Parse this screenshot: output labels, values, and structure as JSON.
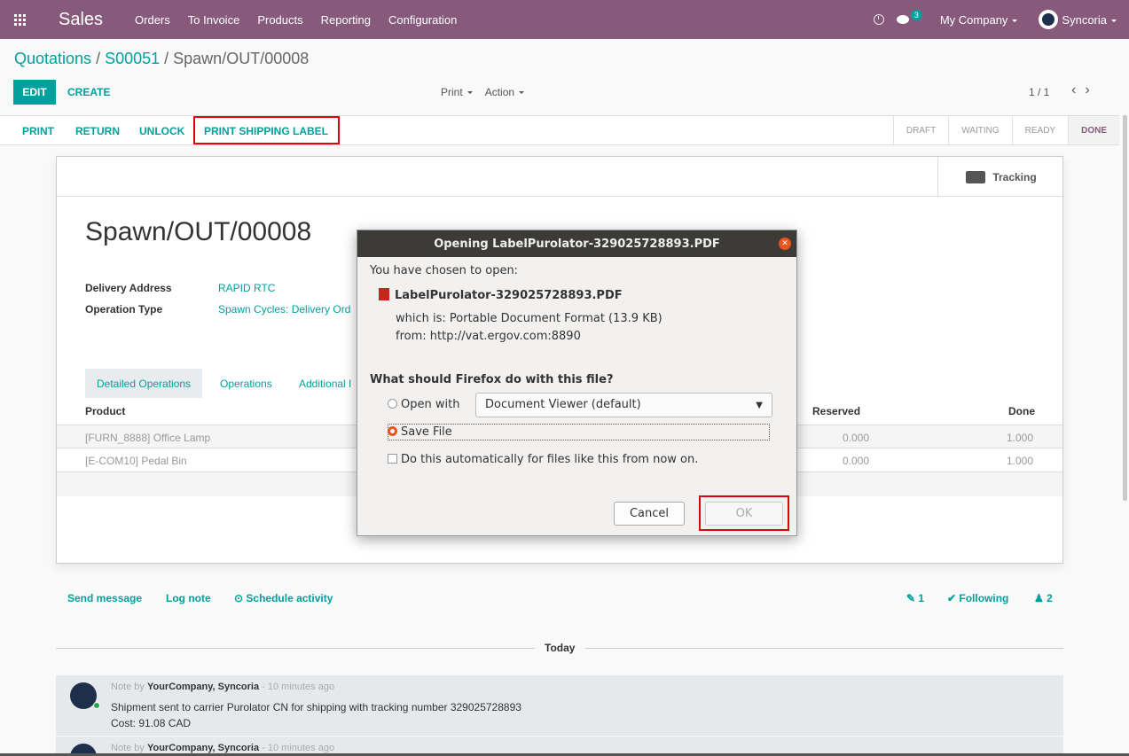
{
  "navbar": {
    "app_name": "Sales",
    "menu": [
      "Orders",
      "To Invoice",
      "Products",
      "Reporting",
      "Configuration"
    ],
    "messages_badge": "3",
    "company": "My Company",
    "user": "Syncoria"
  },
  "breadcrumb": {
    "part1": "Quotations",
    "sep1": " / ",
    "part2": "S00051",
    "sep2": " / ",
    "current": "Spawn/OUT/00008"
  },
  "control_panel": {
    "edit": "EDIT",
    "create": "CREATE",
    "print": "Print",
    "action": "Action",
    "pager": "1 / 1",
    "pager_prev": "‹",
    "pager_next": "›"
  },
  "statusbar": {
    "buttons": [
      "PRINT",
      "RETURN",
      "UNLOCK",
      "PRINT SHIPPING LABEL"
    ],
    "stages": [
      "DRAFT",
      "WAITING",
      "READY",
      "DONE"
    ],
    "active_stage": "DONE"
  },
  "sheet": {
    "tracking": "Tracking",
    "title": "Spawn/OUT/00008",
    "fields": [
      {
        "label": "Delivery Address",
        "value": "RAPID RTC"
      },
      {
        "label": "Operation Type",
        "value": "Spawn Cycles: Delivery Ord"
      }
    ],
    "tabs": [
      "Detailed Operations",
      "Operations",
      "Additional I"
    ],
    "columns": {
      "product": "Product",
      "reserved": "Reserved",
      "done": "Done"
    },
    "rows": [
      {
        "product": "[FURN_8888] Office Lamp",
        "reserved": "0.000",
        "done": "1.000"
      },
      {
        "product": "[E-COM10] Pedal Bin",
        "reserved": "0.000",
        "done": "1.000"
      }
    ]
  },
  "chatter": {
    "send_message": "Send message",
    "log_note": "Log note",
    "schedule_activity": "⊙ Schedule activity",
    "attachments": "✎ 1",
    "following": "✔ Following",
    "followers": "♟ 2",
    "today": "Today",
    "messages": [
      {
        "prefix": "Note by ",
        "author": "YourCompany, Syncoria",
        "time": " - 10 minutes ago",
        "line1": "Shipment sent to carrier Purolator CN for shipping with tracking number 329025728893",
        "line2": "Cost: 91.08 CAD"
      },
      {
        "prefix": "Note by ",
        "author": "YourCompany, Syncoria",
        "time": " - 10 minutes ago"
      }
    ]
  },
  "dialog": {
    "title": "Opening LabelPurolator-329025728893.PDF",
    "chosen": "You have chosen to open:",
    "filename": "LabelPurolator-329025728893.PDF",
    "which_is": "which is: Portable Document Format (13.9 KB)",
    "from": "from: http://vat.ergov.com:8890",
    "question": "What should Firefox do with this file?",
    "open_with": "Open with",
    "open_with_app": "Document Viewer (default)",
    "save_file": "Save File",
    "auto": "Do this automatically for files like this from now on.",
    "cancel": "Cancel",
    "ok": "OK",
    "selected_option": "Save File"
  },
  "colors": {
    "brand": "#875a7b",
    "accent": "#00a09d",
    "highlight": "#e0000a",
    "ubuntu_orange": "#e9541f"
  }
}
